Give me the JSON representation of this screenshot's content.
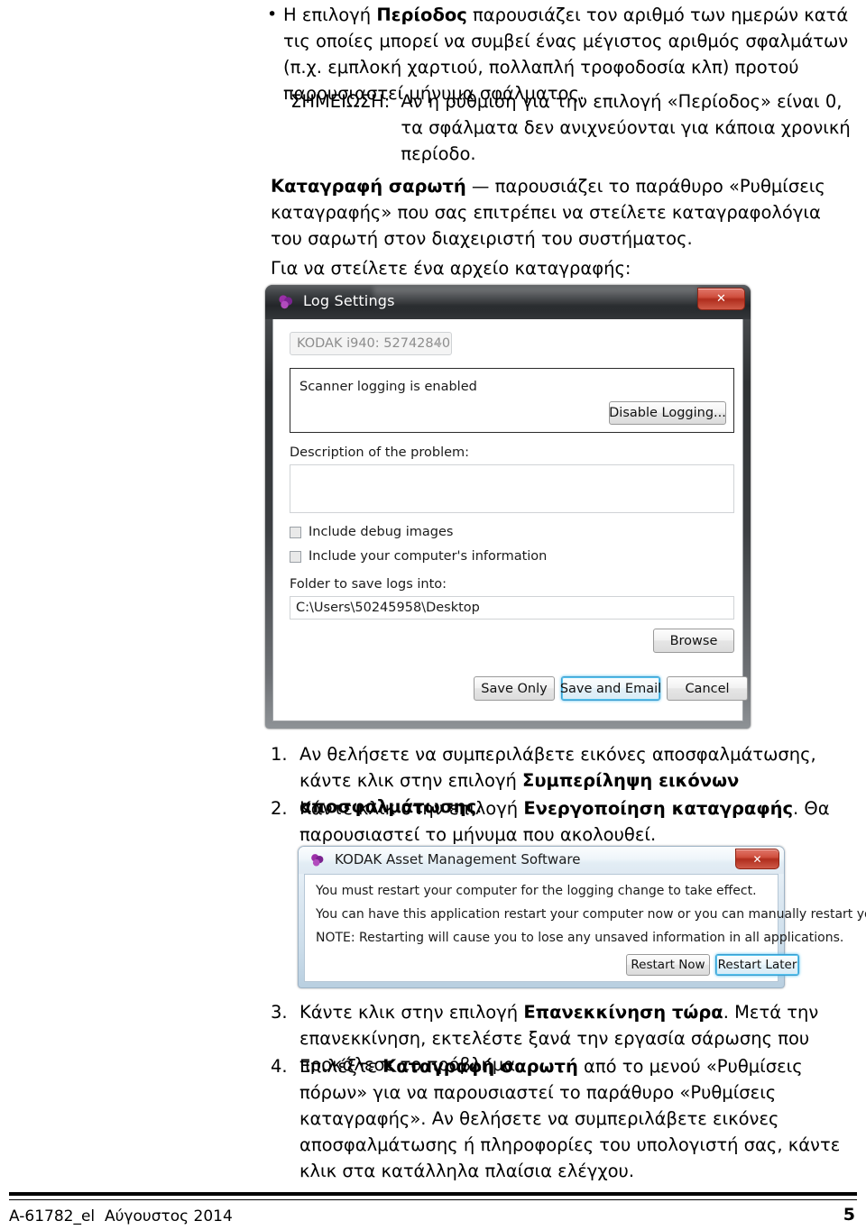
{
  "document": {
    "bullet": {
      "marker": "•",
      "segments": [
        {
          "text": "Η επιλογή ",
          "bold": false
        },
        {
          "text": "Περίοδος",
          "bold": true
        },
        {
          "text": " παρουσιάζει τον αριθμό των ημερών κατά τις οποίες μπορεί να συμβεί ένας μέγιστος αριθμός σφαλμάτων (π.χ. εμπλοκή χαρτιού, πολλαπλή τροφοδοσία κλπ) προτού παρουσιαστεί μήνυμα σφάλματος.",
          "bold": false
        }
      ]
    },
    "note": {
      "label": "ΣΗΜΕΙΩΣΗ:",
      "text": "Αν η ρύθμιση για την επιλογή «Περίοδος» είναι 0, τα σφάλματα δεν ανιχνεύονται για κάποια χρονική περίοδο."
    },
    "para_scanner_log": {
      "segments": [
        {
          "text": "Καταγραφή σαρωτή",
          "bold": true
        },
        {
          "text": " — παρουσιάζει το παράθυρο «Ρυθμίσεις καταγραφής» που σας επιτρέπει να στείλετε καταγραφολόγια του σαρωτή στον διαχειριστή του συστήματος.",
          "bold": false
        }
      ]
    },
    "para_send_log": {
      "segments": [
        {
          "text": "Για να στείλετε ένα αρχείο καταγραφής:",
          "bold": false
        }
      ]
    },
    "steps": [
      {
        "number": "1.",
        "segments": [
          {
            "text": "Αν θελήσετε να συμπεριλάβετε εικόνες αποσφαλμάτωσης, κάντε κλικ στην επιλογή ",
            "bold": false
          },
          {
            "text": "Συμπερίληψη εικόνων αποσφαλμάτωσης",
            "bold": true
          },
          {
            "text": ".",
            "bold": false
          }
        ]
      },
      {
        "number": "2.",
        "segments": [
          {
            "text": "Κάντε κλικ στην επιλογή ",
            "bold": false
          },
          {
            "text": "Ενεργοποίηση καταγραφής",
            "bold": true
          },
          {
            "text": ". Θα παρουσιαστεί το μήνυμα που ακολουθεί.",
            "bold": false
          }
        ]
      },
      {
        "number": "3.",
        "segments": [
          {
            "text": "Κάντε κλικ στην επιλογή ",
            "bold": false
          },
          {
            "text": "Επανεκκίνηση τώρα",
            "bold": true
          },
          {
            "text": ". Μετά την επανεκκίνηση, εκτελέστε ξανά την εργασία σάρωσης που προκάλεσε το πρόβλημα.",
            "bold": false
          }
        ]
      },
      {
        "number": "4.",
        "segments": [
          {
            "text": "Επιλέξτε ",
            "bold": false
          },
          {
            "text": "Καταγραφή σαρωτή",
            "bold": true
          },
          {
            "text": " από το μενού «Ρυθμίσεις πόρων» για να παρουσιαστεί το παράθυρο «Ρυθμίσεις καταγραφής». Αν θελήσετε να συμπεριλάβετε εικόνες αποσφαλμάτωσης ή πληροφορίες του υπολογιστή σας, κάντε κλικ στα κατάλληλα πλαίσια ελέγχου.",
            "bold": false
          }
        ]
      }
    ],
    "footer": {
      "left": "A-61782_el  Αύγουστος 2014",
      "page_number": "5"
    }
  },
  "log_settings_dialog": {
    "title": "Log Settings",
    "close_label": "✕",
    "device_combo": {
      "value": "KODAK i940: 52742840",
      "disabled": true
    },
    "logging_status": "Scanner logging is enabled",
    "disable_logging_label": "Disable Logging...",
    "description_label": "Description of the problem:",
    "description_value": "",
    "checkboxes": [
      {
        "label": "Include debug images",
        "checked": false
      },
      {
        "label": "Include your computer's information",
        "checked": false
      }
    ],
    "folder_label": "Folder to save logs into:",
    "folder_path": "C:\\Users\\50245958\\Desktop",
    "browse_label": "Browse",
    "save_only_label": "Save Only",
    "save_and_email_label": "Save and Email",
    "cancel_label": "Cancel"
  },
  "restart_dialog": {
    "title": "KODAK Asset Management Software",
    "close_label": "✕",
    "messages": [
      "You must restart your computer for the logging change to take effect.",
      "You can have this application restart your computer now or you can manually restart your computer later.",
      "NOTE: Restarting will cause you to lose any unsaved information in all applications."
    ],
    "restart_now_label": "Restart Now",
    "restart_later_label": "Restart Later"
  },
  "colors": {
    "close_button_red": "#b02d1d",
    "focus_border_cyan": "#3c9dd0",
    "title_icon_purple": "#8e3fa8",
    "dark_titlebar": "#232629",
    "light_titlebar": "#eef5fa"
  }
}
